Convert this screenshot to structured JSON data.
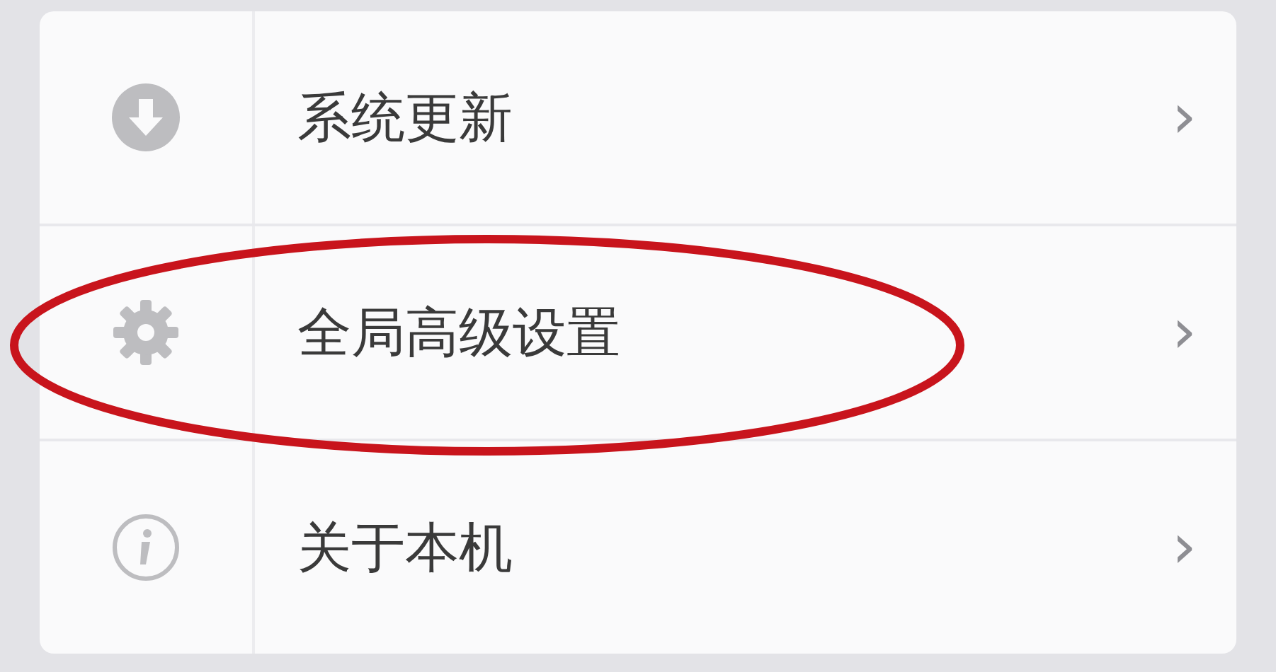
{
  "menu": [
    {
      "kind": "update",
      "label": "系统更新",
      "chevron": "›",
      "highlighted": false
    },
    {
      "kind": "settings",
      "label": "全局高级设置",
      "chevron": "›",
      "highlighted": true
    },
    {
      "kind": "about",
      "label": "关于本机",
      "chevron": "›",
      "highlighted": false
    }
  ]
}
